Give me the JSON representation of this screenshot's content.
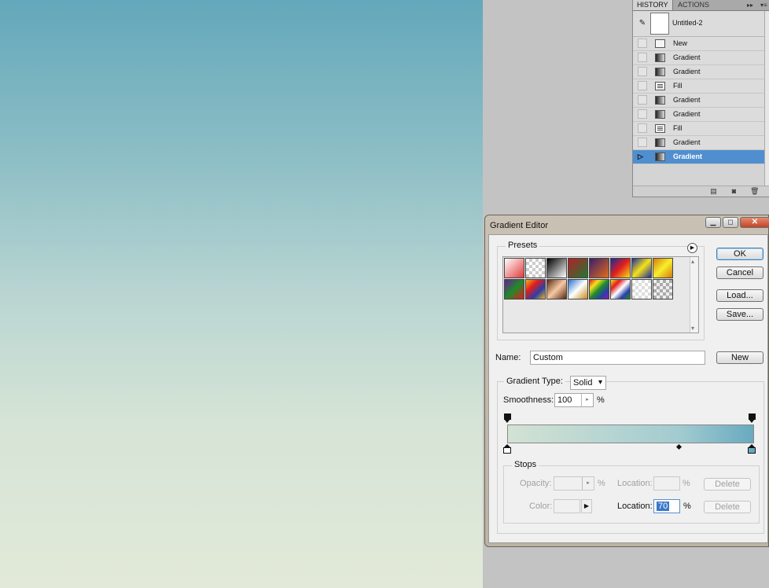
{
  "history_panel": {
    "tabs": [
      "HISTORY",
      "ACTIONS"
    ],
    "menu_icon": "panel-menu-icon",
    "snapshot_label": "Untitled-2",
    "items": [
      {
        "label": "New",
        "icon": "new-document-icon",
        "selected": false
      },
      {
        "label": "Gradient",
        "icon": "gradient-icon",
        "selected": false
      },
      {
        "label": "Gradient",
        "icon": "gradient-icon",
        "selected": false
      },
      {
        "label": "Fill",
        "icon": "fill-icon",
        "selected": false
      },
      {
        "label": "Gradient",
        "icon": "gradient-icon",
        "selected": false
      },
      {
        "label": "Gradient",
        "icon": "gradient-icon",
        "selected": false
      },
      {
        "label": "Fill",
        "icon": "fill-icon",
        "selected": false
      },
      {
        "label": "Gradient",
        "icon": "gradient-icon",
        "selected": false
      },
      {
        "label": "Gradient",
        "icon": "gradient-icon",
        "selected": true
      }
    ],
    "footer_icons": [
      "new-document-from-state-icon",
      "new-snapshot-icon",
      "delete-icon"
    ]
  },
  "dialog": {
    "title": "Gradient Editor",
    "presets_label": "Presets",
    "buttons": {
      "ok": "OK",
      "cancel": "Cancel",
      "load": "Load...",
      "save": "Save...",
      "new": "New"
    },
    "name_label": "Name:",
    "name_value": "Custom",
    "gradient_group": {
      "type_label": "Gradient Type:",
      "type_value": "Solid",
      "smoothness_label": "Smoothness:",
      "smoothness_value": "100",
      "percent": "%"
    },
    "gradient_colors": {
      "left": "#d3e2d4",
      "mid": "#a2cbd0",
      "right": "#68aac0"
    },
    "stops": {
      "legend": "Stops",
      "opacity_label": "Opacity:",
      "opacity_location_label": "Location:",
      "color_label": "Color:",
      "color_location_label": "Location:",
      "color_location_value": "70",
      "percent": "%",
      "delete_label": "Delete"
    }
  },
  "canvas_colors": {
    "top": "#63a8bb",
    "bottom": "#e2e9d9"
  }
}
